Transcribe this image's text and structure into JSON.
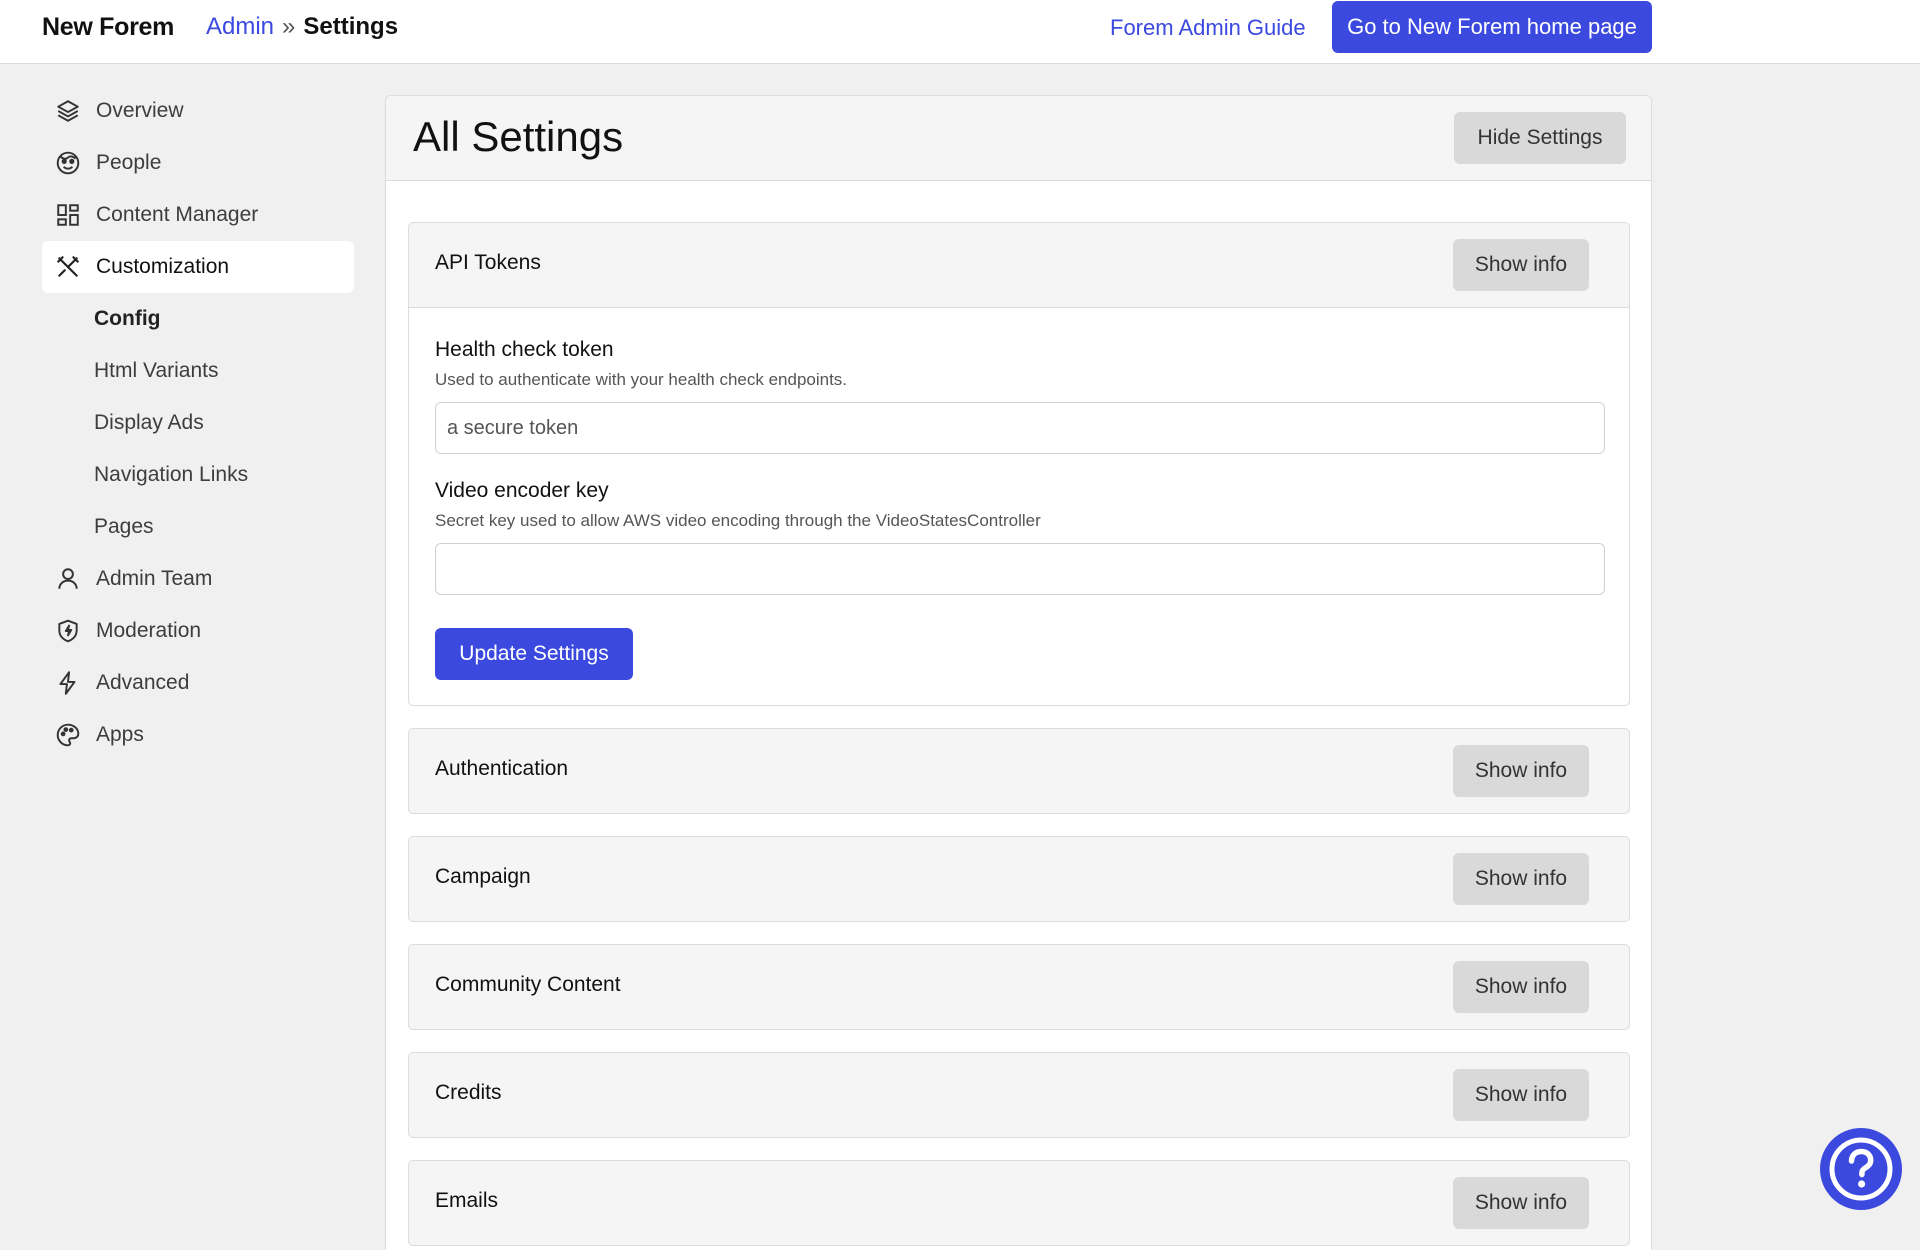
{
  "header": {
    "brand": "New Forem",
    "breadcrumb_admin": "Admin",
    "breadcrumb_sep": "»",
    "breadcrumb_current": "Settings",
    "guide_link": "Forem Admin Guide",
    "home_button": "Go to New Forem home page"
  },
  "sidebar": {
    "items": [
      {
        "label": "Overview",
        "icon": "layers-icon"
      },
      {
        "label": "People",
        "icon": "face-icon"
      },
      {
        "label": "Content Manager",
        "icon": "dashboard-icon"
      },
      {
        "label": "Customization",
        "icon": "tools-icon",
        "active": true
      },
      {
        "label": "Admin Team",
        "icon": "user-icon"
      },
      {
        "label": "Moderation",
        "icon": "shield-icon"
      },
      {
        "label": "Advanced",
        "icon": "lightning-icon"
      },
      {
        "label": "Apps",
        "icon": "palette-icon"
      }
    ],
    "subitems": [
      {
        "label": "Config",
        "current": true
      },
      {
        "label": "Html Variants"
      },
      {
        "label": "Display Ads"
      },
      {
        "label": "Navigation Links"
      },
      {
        "label": "Pages"
      }
    ]
  },
  "main": {
    "title": "All Settings",
    "hide_button": "Hide Settings",
    "sections": [
      {
        "title": "API Tokens",
        "button": "Show info"
      },
      {
        "title": "Authentication",
        "button": "Show info"
      },
      {
        "title": "Campaign",
        "button": "Show info"
      },
      {
        "title": "Community Content",
        "button": "Show info"
      },
      {
        "title": "Credits",
        "button": "Show info"
      },
      {
        "title": "Emails",
        "button": "Show info"
      }
    ],
    "api_tokens": {
      "health_label": "Health check token",
      "health_help": "Used to authenticate with your health check endpoints.",
      "health_placeholder": "a secure token",
      "video_label": "Video encoder key",
      "video_help": "Secret key used to allow AWS video encoding through the VideoStatesController",
      "video_value": "",
      "update_button": "Update Settings"
    }
  },
  "colors": {
    "accent": "#3b49df",
    "page_bg": "#f0f0f0",
    "button_gray": "#d9d9d9"
  }
}
